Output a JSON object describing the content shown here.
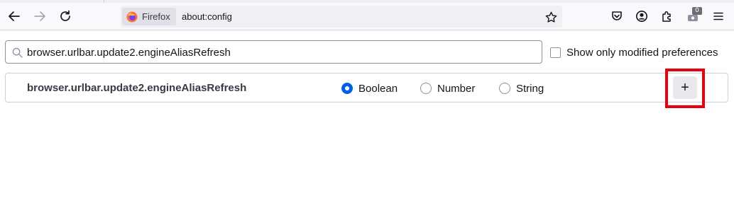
{
  "browser": {
    "identity_label": "Firefox",
    "url": "about:config",
    "extension_badge": "0",
    "icons": {
      "back": "back-arrow-icon",
      "forward": "forward-arrow-icon",
      "reload": "reload-icon",
      "firefox_logo": "firefox-logo-icon",
      "bookmark": "star-icon",
      "pocket": "pocket-icon",
      "account": "account-icon",
      "extensions": "puzzle-icon",
      "extension_item": "extension-icon",
      "menu": "hamburger-menu-icon"
    }
  },
  "config": {
    "search_value": "browser.urlbar.update2.engineAliasRefresh",
    "show_modified_label": "Show only modified preferences",
    "new_pref": {
      "name": "browser.urlbar.update2.engineAliasRefresh",
      "types": [
        {
          "label": "Boolean",
          "checked": true
        },
        {
          "label": "Number",
          "checked": false
        },
        {
          "label": "String",
          "checked": false
        }
      ],
      "add_label": "+"
    }
  },
  "colors": {
    "accent": "#0061e0",
    "highlight": "#e8000b"
  }
}
